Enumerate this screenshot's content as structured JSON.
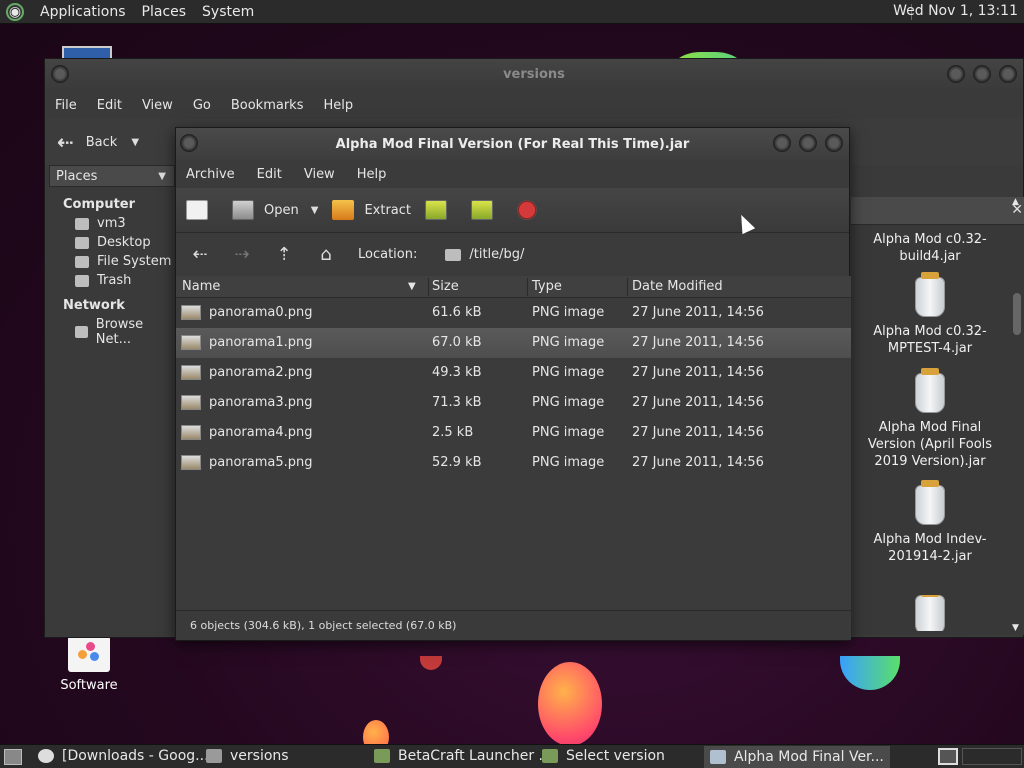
{
  "top_panel": {
    "menu": [
      "Applications",
      "Places",
      "System"
    ],
    "clock": "Wed Nov 1, 13:11"
  },
  "desktop": {
    "icons": [
      {
        "label": "Software"
      }
    ]
  },
  "back_window": {
    "title": "versions",
    "menu": [
      "File",
      "Edit",
      "View",
      "Go",
      "Bookmarks",
      "Help"
    ],
    "back_label": "Back",
    "places_label": "Places",
    "sidebar": {
      "computer_header": "Computer",
      "computer_items": [
        "vm3",
        "Desktop",
        "File System",
        "Trash"
      ],
      "network_header": "Network",
      "network_items": [
        "Browse Net..."
      ]
    },
    "right_items": [
      "Alpha Mod c0.32-build4.jar",
      "Alpha Mod c0.32-MPTEST-4.jar",
      "Alpha Mod Final Version (April Fools 2019 Version).jar",
      "Alpha Mod Indev-201914-2.jar"
    ]
  },
  "front_window": {
    "title": "Alpha Mod Final Version (For Real This Time).jar",
    "menu": [
      "Archive",
      "Edit",
      "View",
      "Help"
    ],
    "toolbar": {
      "open": "Open",
      "extract": "Extract"
    },
    "location_label": "Location:",
    "location_path": "/title/bg/",
    "columns": [
      "Name",
      "Size",
      "Type",
      "Date Modified"
    ],
    "rows": [
      {
        "name": "panorama0.png",
        "size": "61.6 kB",
        "type": "PNG image",
        "date": "27 June 2011, 14:56"
      },
      {
        "name": "panorama1.png",
        "size": "67.0 kB",
        "type": "PNG image",
        "date": "27 June 2011, 14:56"
      },
      {
        "name": "panorama2.png",
        "size": "49.3 kB",
        "type": "PNG image",
        "date": "27 June 2011, 14:56"
      },
      {
        "name": "panorama3.png",
        "size": "71.3 kB",
        "type": "PNG image",
        "date": "27 June 2011, 14:56"
      },
      {
        "name": "panorama4.png",
        "size": "2.5 kB",
        "type": "PNG image",
        "date": "27 June 2011, 14:56"
      },
      {
        "name": "panorama5.png",
        "size": "52.9 kB",
        "type": "PNG image",
        "date": "27 June 2011, 14:56"
      }
    ],
    "selected_row": 1,
    "status": "6 objects (304.6 kB), 1 object selected (67.0 kB)"
  },
  "taskbar": {
    "tasks": [
      "[Downloads - Goog...",
      "versions",
      "BetaCraft Launcher ...",
      "Select version",
      "Alpha Mod Final Ver..."
    ]
  }
}
